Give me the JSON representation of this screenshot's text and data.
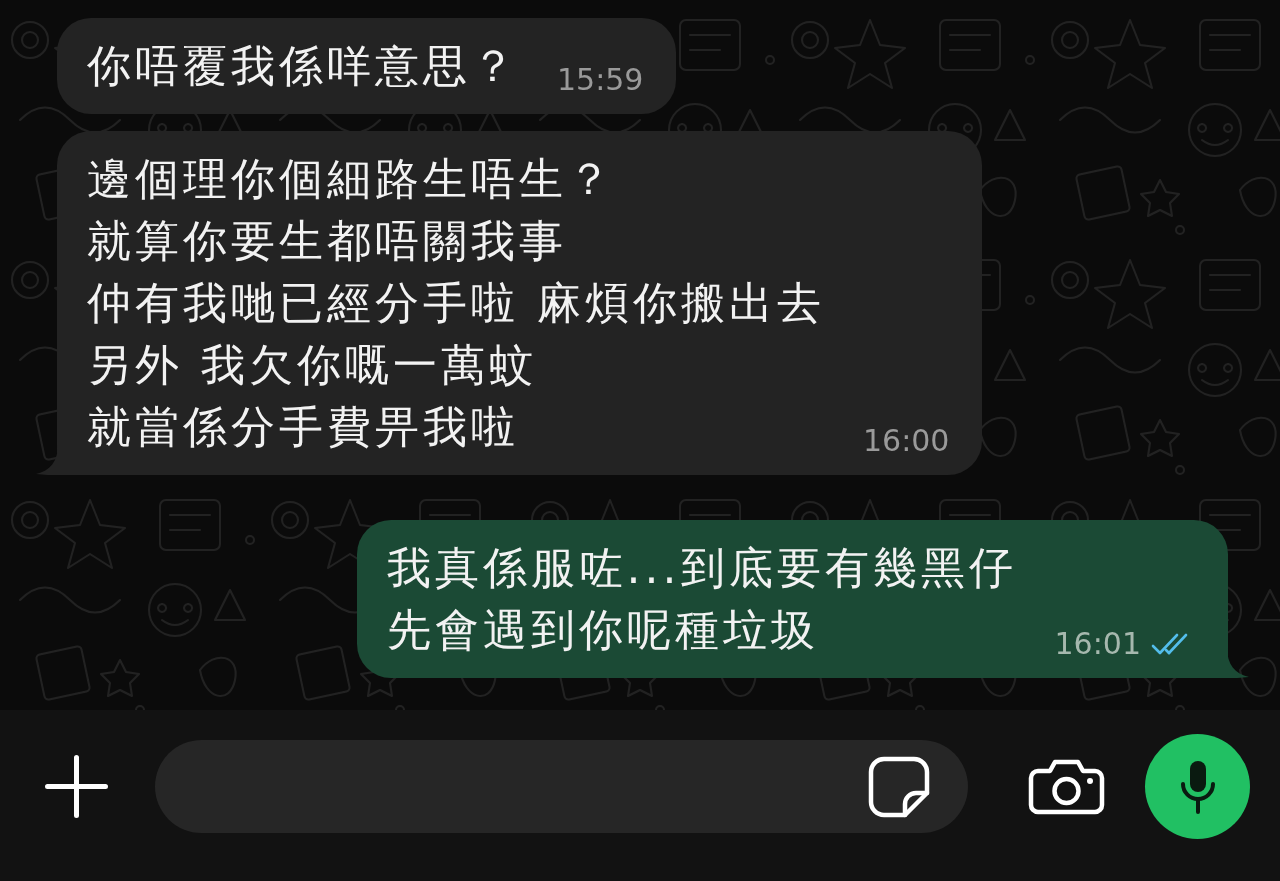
{
  "messages": [
    {
      "kind": "incoming",
      "lines": [
        "你唔覆我係咩意思？"
      ],
      "time": "15:59",
      "tail": false
    },
    {
      "kind": "incoming",
      "lines": [
        "邊個理你個細路生唔生？",
        "就算你要生都唔關我事",
        "仲有我哋已經分手啦 麻煩你搬出去",
        "另外 我欠你嘅一萬蚊",
        "就當係分手費畀我啦"
      ],
      "time": "16:00",
      "tail": true
    },
    {
      "kind": "outgoing",
      "lines": [
        "我真係服咗...到底要有幾黑仔",
        "先會遇到你呢種垃圾"
      ],
      "time": "16:01",
      "tail": true,
      "read": true
    }
  ]
}
